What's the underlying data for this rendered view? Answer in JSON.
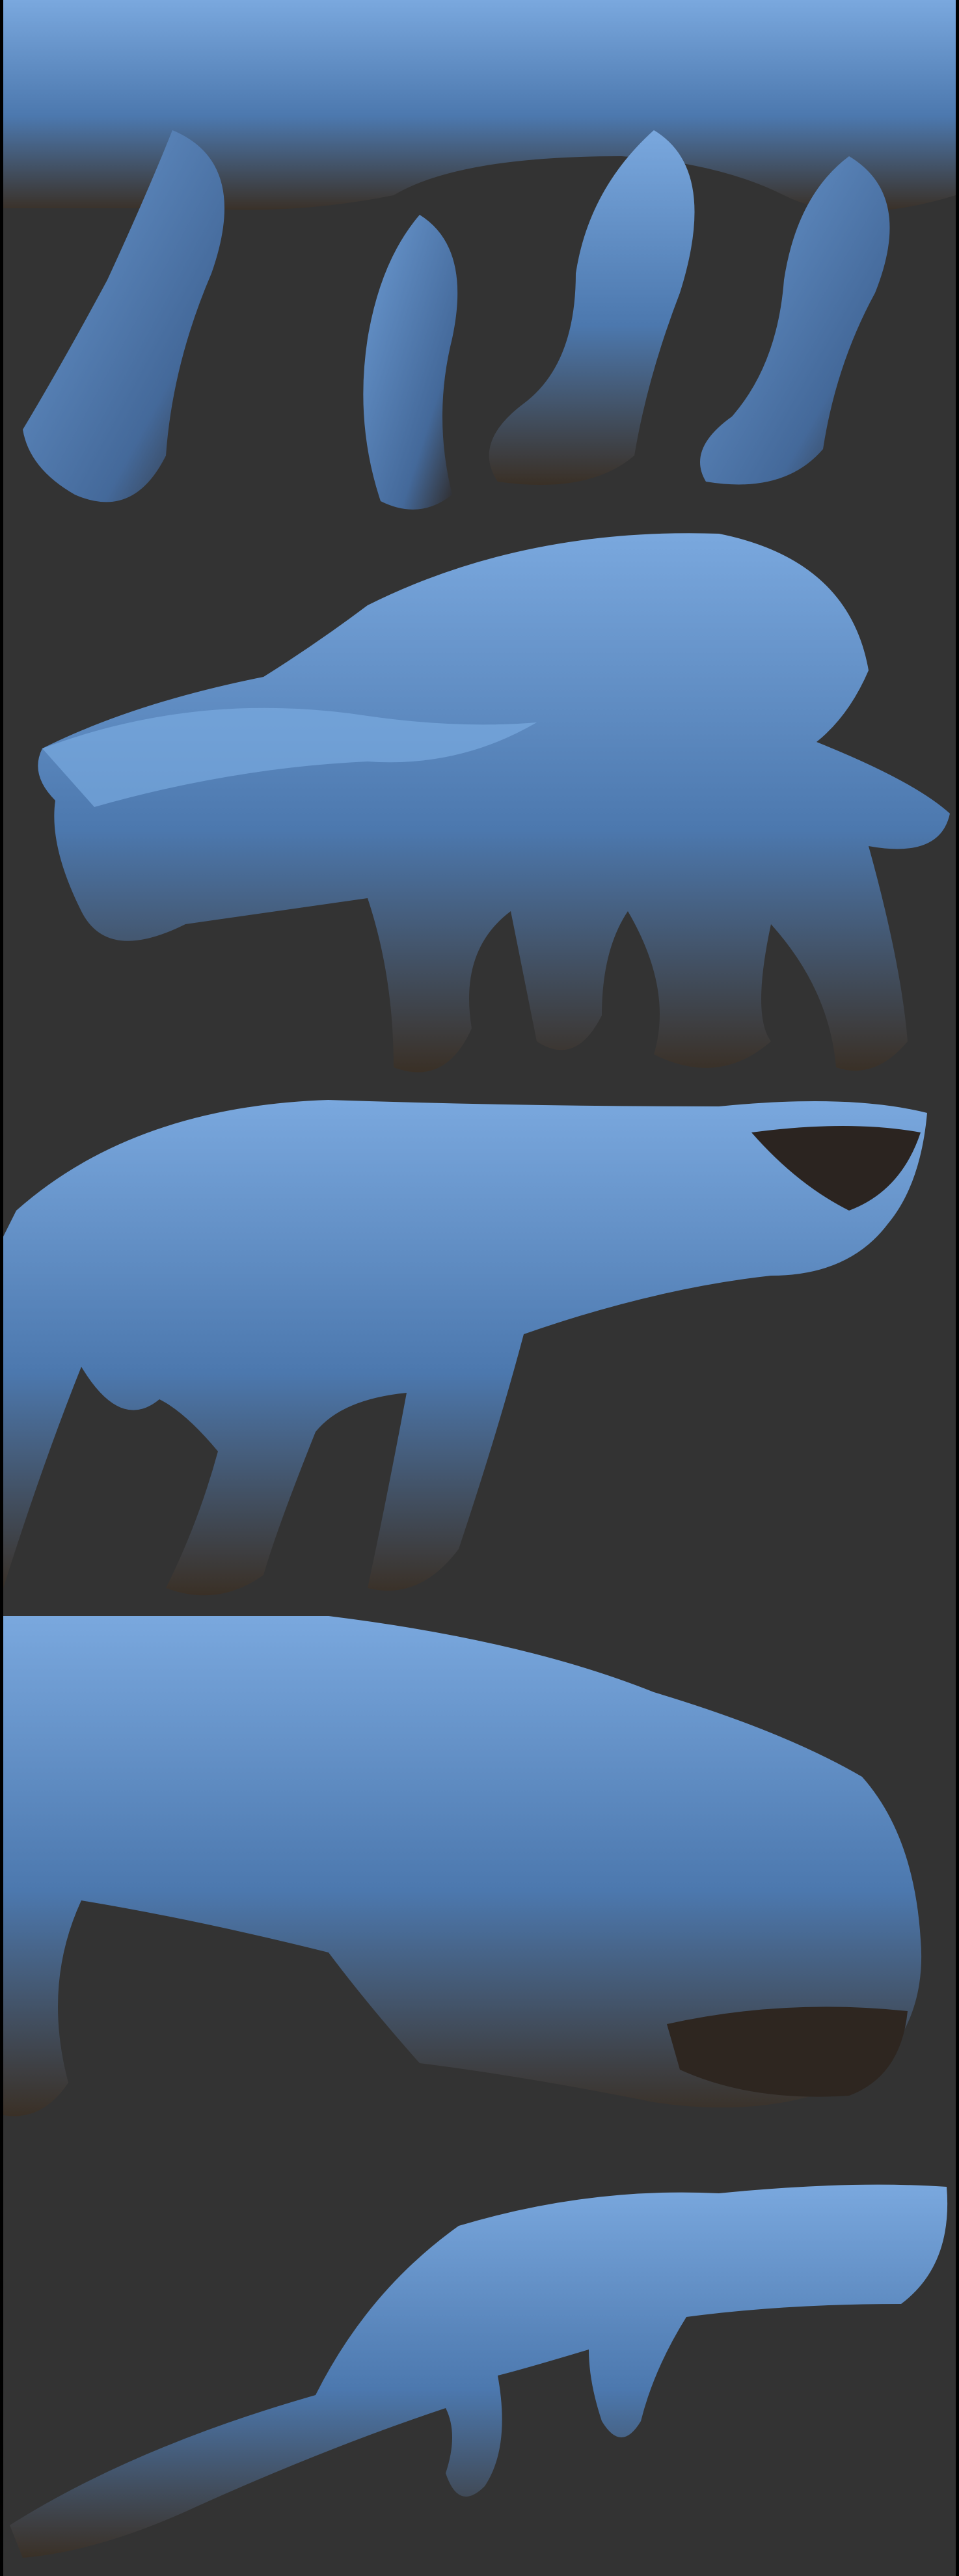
{
  "image": {
    "subject": "creature-sculpt-renders",
    "panel_count": 5,
    "colors": {
      "background": "#333333",
      "border": "#000000",
      "material_light": "#6f9fd6",
      "material_mid": "#4a76ad",
      "material_shadow": "#3b2a1e"
    }
  }
}
